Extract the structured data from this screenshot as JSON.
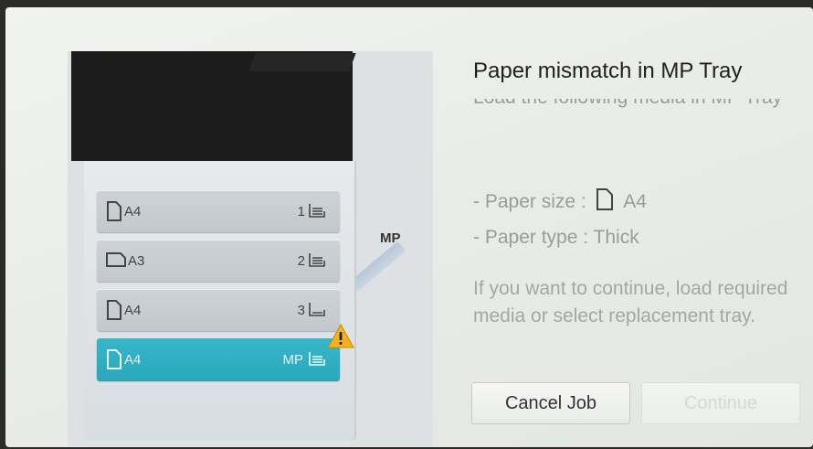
{
  "dialog": {
    "title": "Paper mismatch in MP Tray",
    "message": "Load the following media in MP Tray",
    "paper_size_label": "- Paper size :",
    "paper_size_value": "A4",
    "paper_type_label": "- Paper type : Thick",
    "note": "If you want to continue, load required media or select replacement tray.",
    "buttons": {
      "cancel": "Cancel Job",
      "continue": "Continue"
    }
  },
  "printer": {
    "mp_label": "MP",
    "trays": [
      {
        "size": "A4",
        "number": "1",
        "orientation": "portrait",
        "selected": false
      },
      {
        "size": "A3",
        "number": "2",
        "orientation": "landscape",
        "selected": false
      },
      {
        "size": "A4",
        "number": "3",
        "orientation": "portrait",
        "selected": false
      },
      {
        "size": "A4",
        "number": "MP",
        "orientation": "portrait",
        "selected": true,
        "warning": true
      }
    ]
  },
  "colors": {
    "accent": "#2aa7bc",
    "warning": "#f2b31b"
  },
  "icons": [
    "document-icon",
    "paper-stack-icon",
    "warning-icon"
  ]
}
